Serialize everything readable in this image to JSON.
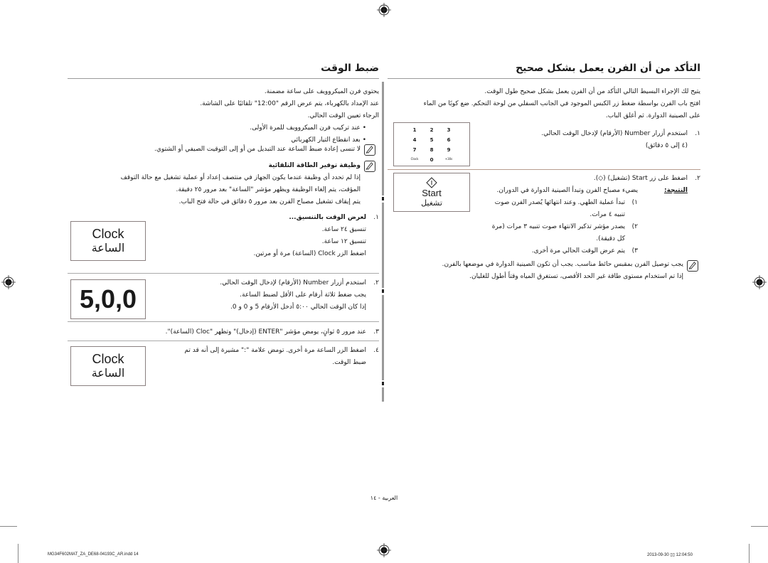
{
  "right_section": {
    "title": "التأكد من أن الفرن يعمل بشكل صحيح",
    "intro": [
      "يتيح لك الإجراء البسيط التالي التأكد من أن الفرن يعمل بشكل صحيح طول الوقت.",
      "افتح باب الفرن بواسطة ضغط زر الكبس الموجود في الجانب السفلي من لوحة التحكم. ضع كوبًا من الماء",
      "على الصينية الدوارة. ثم أغلق الباب."
    ],
    "step1": {
      "num": "١.",
      "line1": "استخدم أزرار Number (الأرقام) لإدخال الوقت الحالي.",
      "line2": "(٤ إلى ٥ دقائق)"
    },
    "keypad": {
      "keys": [
        "1",
        "2",
        "3",
        "4",
        "5",
        "6",
        "7",
        "8",
        "9",
        "Clock",
        "0",
        "+30s"
      ]
    },
    "step2": {
      "num": "٢.",
      "line1": "اضغط على زر Start (تشغيل) (◇).",
      "result_label": "النتيجة:",
      "result_text": "يضيء مصباح الفرن وتبدأ الصينية الدوارة في الدوران.",
      "sub_items": [
        {
          "num": "١)",
          "text": "تبدأ عملية الطهي. وعند انتهائها يُصدر الفرن صوت تنبيه ٤ مرات."
        },
        {
          "num": "٢)",
          "text": "يصدر مؤشر تذكير الانتهاء صوت تنبيه ٣ مرات (مرة كل دقيقة)."
        },
        {
          "num": "٣)",
          "text": "يتم عرض الوقت الحالي مرة أخرى."
        }
      ]
    },
    "start_button": {
      "label_en": "Start",
      "label_ar": "تشغيل"
    },
    "note": [
      "يجب توصيل الفرن بمقبس حائط مناسب. يجب أن تكون الصينية الدوارة في موضعها بالفرن.",
      "إذا تم استخدام مستوى طاقة غير الحد الأقصى، تستغرق المياه وقتاً أطول للغليان."
    ]
  },
  "left_section": {
    "title": "ضبط الوقت",
    "intro": [
      "يحتوي فرن الميكروويف على ساعة مضمنة.",
      "عند الإمداد بالكهرباء، يتم عرض الرقم \"12:00\" تلقائيًا على الشاشة.",
      "الرجاء تعيين الوقت الحالي."
    ],
    "bullets": [
      "عند تركيب فرن الميكروويف للمرة الأولى.",
      "بعد انقطاع التيار الكهربائي"
    ],
    "note1": "لا تنسى إعادة ضبط الساعة عند التبديل من أو إلى التوقيت الصيفي أو الشتوي.",
    "note2_title": "وظيفة توفير الطاقة التلقائية",
    "note2_lines": [
      "إذا لم تحدد أي وظيفة عندما يكون الجهاز في منتصف إعداد أو عملية تشغيل مع حالة التوقف",
      "المؤقت، يتم إلغاء الوظيفة ويظهر مؤشر \"الساعة\" بعد مرور ٢٥ دقيقة.",
      "يتم إيقاف تشغيل مصباح الفرن بعد مرور ٥ دقائق في حالة فتح الباب."
    ],
    "step1": {
      "num": "١.",
      "title": "لعرض الوقت بالتنسيق...",
      "lines": [
        "تنسيق ٢٤ ساعة.",
        "تنسيق ١٢ ساعة."
      ],
      "action": "اضغط الزر Clock (الساعة) مرة أو مرتين."
    },
    "step2": {
      "num": "٢.",
      "lines": [
        "استخدم أزرار Number (الأرقام) لإدخال الوقت الحالي.",
        "يجب ضغط ثلاثة أرقام على الأقل لضبط الساعة.",
        "إذا كان الوقت الحالي ٥:٠٠ أدخل الأرقام 5 و 0 و 0."
      ]
    },
    "step3": {
      "num": "٣.",
      "text": "عند مرور ٥ ثوانٍ، يومض مؤشر \"ENTER (إدخال)\" وتظهر \"Cloc (الساعة)\"."
    },
    "step4": {
      "num": "٤.",
      "lines": [
        "اضغط الزر الساعة مرة أخرى. تومض علامة \":\" مشيرة إلى أنه قد تم",
        "ضبط الوقت."
      ]
    },
    "clock_button": {
      "label_en": "Clock",
      "label_ar": "الساعة"
    },
    "display": {
      "value": "5,0,0"
    }
  },
  "footer": {
    "page_label": "العربية - ١٤",
    "file_name": "MG34F602MAT_ZA_DE68-04193C_AR.indd   14",
    "timestamp": "2013-09-30  ▯▯ 12:04:50"
  }
}
